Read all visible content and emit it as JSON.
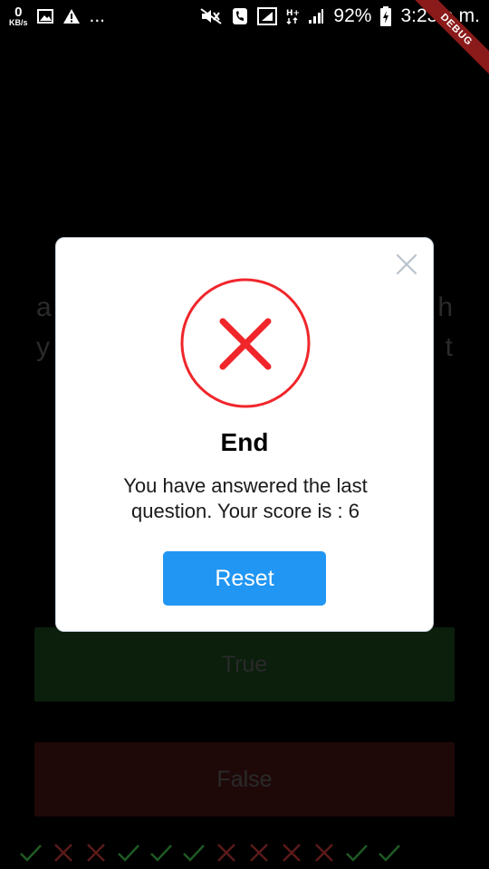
{
  "status_bar": {
    "net_speed_value": "0",
    "net_speed_unit": "KB/s",
    "more_indicator": "...",
    "battery": "92%",
    "time": "3:23 a.m."
  },
  "debug_banner": "DEBUG",
  "background": {
    "question_left": [
      "a",
      "y"
    ],
    "question_right": [
      "h",
      "t"
    ],
    "true_label": "True",
    "false_label": "False",
    "score_marks": [
      "check",
      "cross",
      "cross",
      "check",
      "check",
      "check",
      "cross",
      "cross",
      "cross",
      "cross",
      "check",
      "check"
    ]
  },
  "dialog": {
    "title": "End",
    "description": "You have answered the last question. Your score is : 6",
    "reset_label": "Reset",
    "icon": "error-cross-icon",
    "accent_color": "#f0262b",
    "button_color": "#2196f3"
  },
  "colors": {
    "check": "#1f5a24",
    "cross": "#5a1a1a"
  }
}
